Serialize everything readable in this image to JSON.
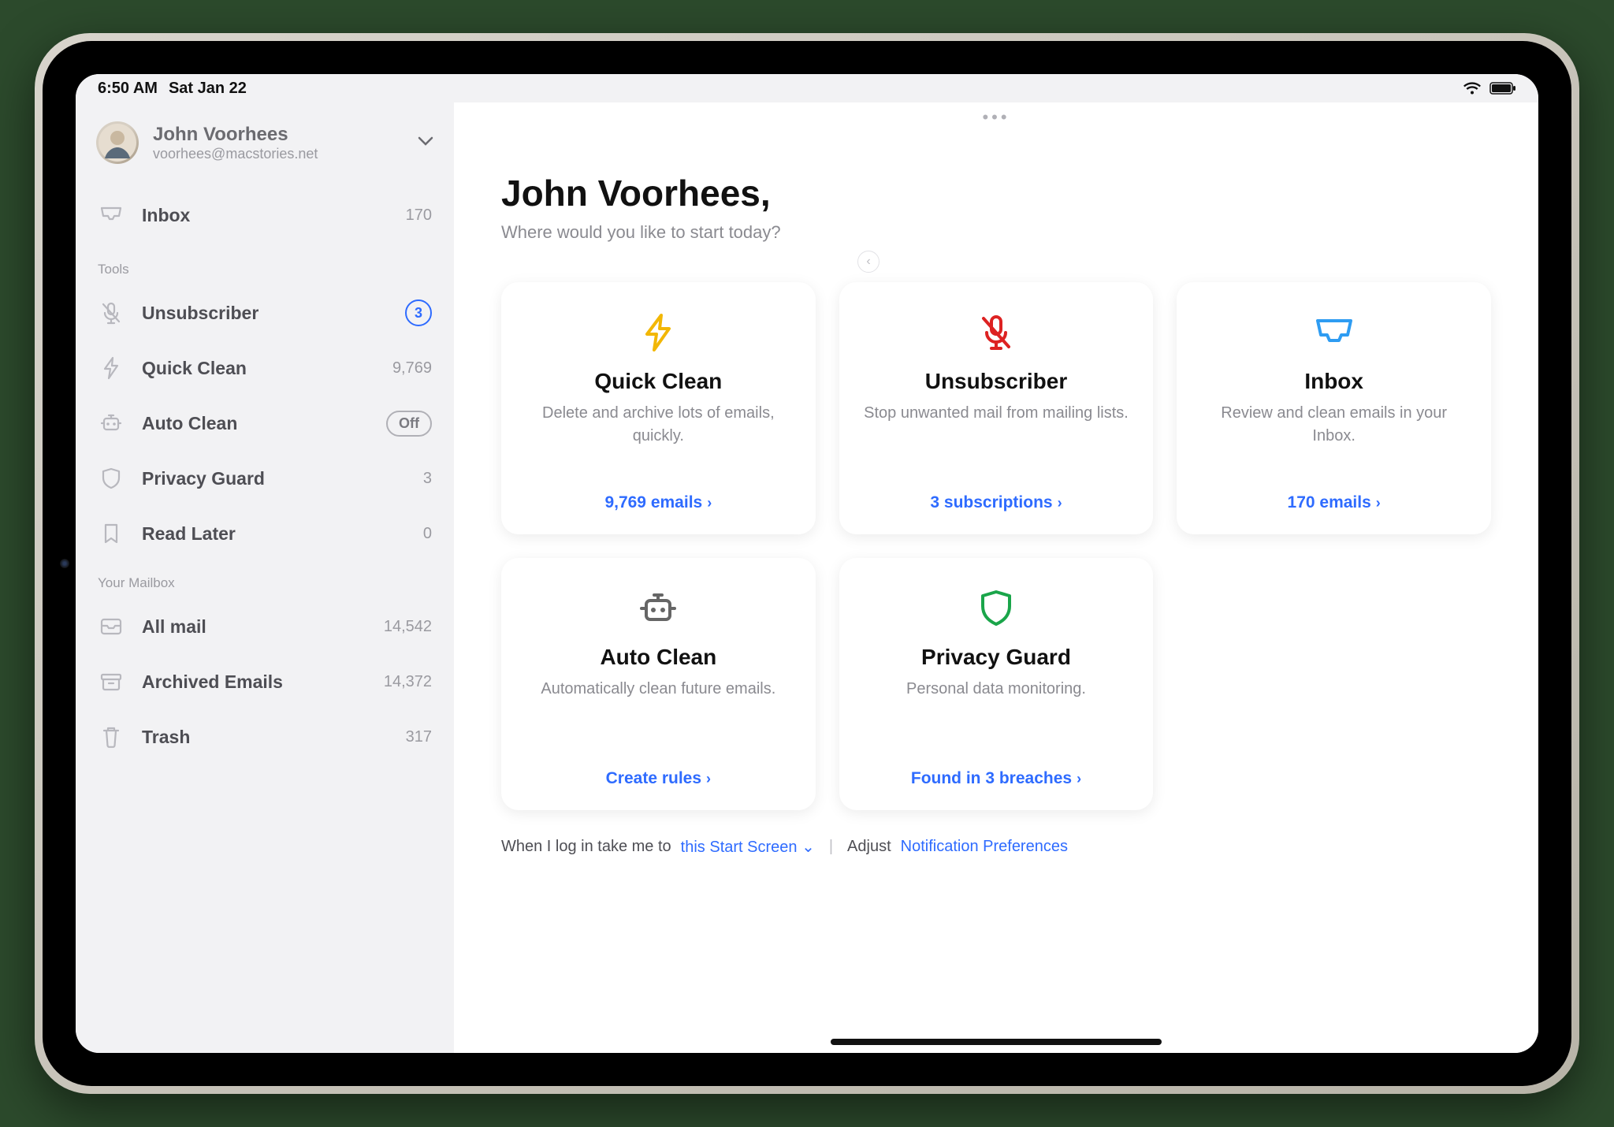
{
  "status": {
    "time": "6:50 AM",
    "date": "Sat Jan 22"
  },
  "account": {
    "name": "John Voorhees",
    "email": "voorhees@macstories.net"
  },
  "sidebar": {
    "inbox": {
      "label": "Inbox",
      "count": "170"
    },
    "tools_header": "Tools",
    "unsubscriber": {
      "label": "Unsubscriber",
      "badge": "3"
    },
    "quick_clean": {
      "label": "Quick Clean",
      "count": "9,769"
    },
    "auto_clean": {
      "label": "Auto Clean",
      "badge": "Off"
    },
    "privacy_guard": {
      "label": "Privacy Guard",
      "count": "3"
    },
    "read_later": {
      "label": "Read Later",
      "count": "0"
    },
    "mailbox_header": "Your Mailbox",
    "all_mail": {
      "label": "All mail",
      "count": "14,542"
    },
    "archived": {
      "label": "Archived Emails",
      "count": "14,372"
    },
    "trash": {
      "label": "Trash",
      "count": "317"
    }
  },
  "main": {
    "greeting_name": "John Voorhees,",
    "greeting_sub": "Where would you like to start today?",
    "cards": {
      "quick_clean": {
        "title": "Quick Clean",
        "desc": "Delete and archive lots of emails, quickly.",
        "link": "9,769 emails"
      },
      "unsubscriber": {
        "title": "Unsubscriber",
        "desc": "Stop unwanted mail from mailing lists.",
        "link": "3 subscriptions"
      },
      "inbox": {
        "title": "Inbox",
        "desc": "Review and clean emails in your Inbox.",
        "link": "170 emails"
      },
      "auto_clean": {
        "title": "Auto Clean",
        "desc": "Automatically clean future emails.",
        "link": "Create rules"
      },
      "privacy_guard": {
        "title": "Privacy Guard",
        "desc": "Personal data monitoring.",
        "link": "Found in 3 breaches"
      }
    },
    "footer": {
      "prefix": "When I log in take me to",
      "link1": "this Start Screen",
      "middle": "Adjust",
      "link2": "Notification Preferences"
    }
  }
}
